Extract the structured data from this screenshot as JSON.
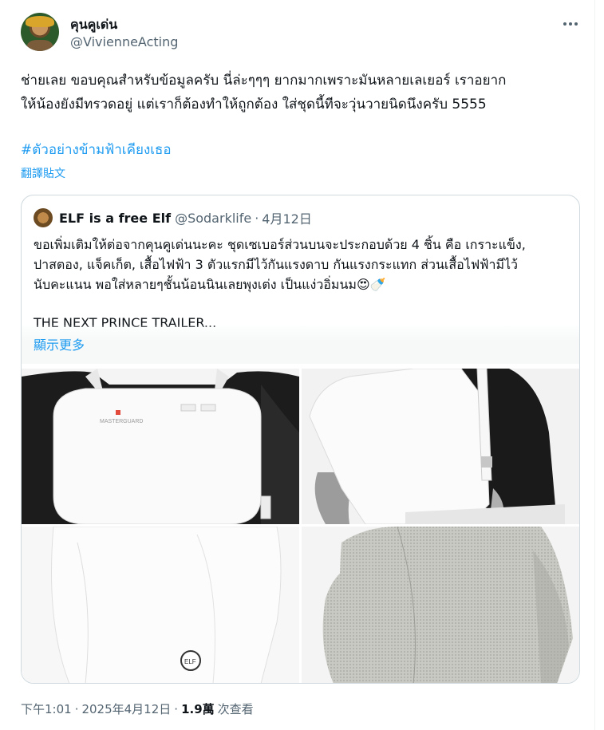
{
  "tweet": {
    "display_name": "คุนคูเด่น",
    "handle": "@VivienneActing",
    "body": "ช่ายเลย ขอบคุณสำหรับข้อมูลครับ นี่ล่ะๆๆๆ ยากมากเพราะมันหลายเลเยอร์ เราอยาก\nให้น้องยังมีทรวดอยู่ แต่เราก็ต้องทำให้ถูกต้อง ใส่ชุดนี้ทีจะวุ่นวายนิดนึงครับ 5555",
    "hashtag": "#ตัวอย่างข้ามฟ้าเคียงเธอ",
    "translate_label": "翻譯貼文"
  },
  "quote": {
    "display_name": "ELF is a free Elf",
    "handle": "@Sodarklife",
    "dot": "·",
    "date": "4月12日",
    "body": "ขอเพิ่มเติมให้ต่อจากคุนคูเด่นนะคะ ชุดเซเบอร์ส่วนบนจะประกอบด้วย 4 ชิ้น คือ เกราะแข็ง,\nปาสตอง, แจ็คเก็ต, เสื้อไฟฟ้า 3 ตัวแรกมีไว้กันแรงดาบ กันแรงกระแทก ส่วนเสื้อไฟฟ้ามีไว้\nนับคะแนน พอใส่หลายๆชั้นน้อนนินเลยพุงเต่ง เป็นแง่วอิ่มนม😍🍼",
    "trailer": "THE NEXT PRINCE TRAILER...",
    "show_more": "顯示更多",
    "photo_brand": "MASTERGUARD",
    "photo_patch": "ELF"
  },
  "meta": {
    "time": "下午1:01",
    "dot1": "·",
    "date": "2025年4月12日",
    "dot2": "·",
    "views_count": "1.9萬",
    "views_label": "次查看"
  },
  "icons": {
    "more": "more-horizontal-icon"
  }
}
